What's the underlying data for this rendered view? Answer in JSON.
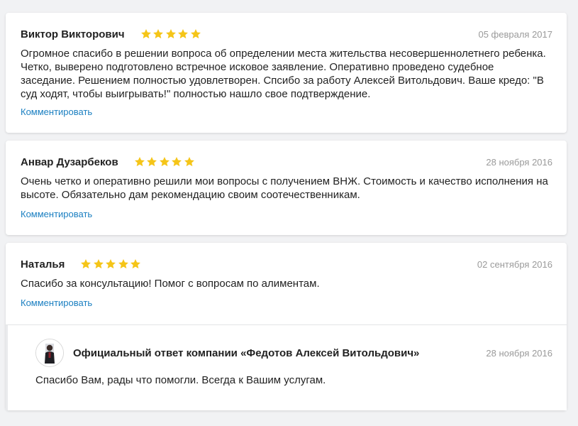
{
  "colors": {
    "page_background": "#f1f2f4",
    "card_background": "#ffffff",
    "star": "#f5c518",
    "link": "#1a7fc1",
    "date": "#9a9a9a"
  },
  "reviews": [
    {
      "author": "Виктор Викторович",
      "rating": 5,
      "date": "05 февраля 2017",
      "text": "Огромное спасибо в решении вопроса об определении места жительства несовершеннолетнего ребенка. Четко, выверено подготовлено встречное исковое заявление. Оперативно проведено судебное заседание. Решением полностью удовлетворен. Спсибо за работу Алексей Витольдович. Ваше кредо: \"В суд ходят, чтобы выигрывать!\" полностью нашло свое подтверждение.",
      "comment_label": "Комментировать"
    },
    {
      "author": "Анвар Дузарбеков",
      "rating": 5,
      "date": "28 ноября 2016",
      "text": "Очень четко и оперативно решили мои вопросы с получением ВНЖ. Стоимость и качество исполнения на высоте. Обязательно дам рекомендацию своим соотечественникам.",
      "comment_label": "Комментировать"
    },
    {
      "author": "Наталья",
      "rating": 5,
      "date": "02 сентября 2016",
      "text": "Спасибо за консультацию! Помог с вопросам по алиментам.",
      "comment_label": "Комментировать",
      "reply": {
        "title": "Официальный ответ компании «Федотов Алексей Витольдович»",
        "date": "28 ноября 2016",
        "text": "Спасибо Вам, рады что помогли. Всегда к Вашим услугам."
      }
    }
  ]
}
